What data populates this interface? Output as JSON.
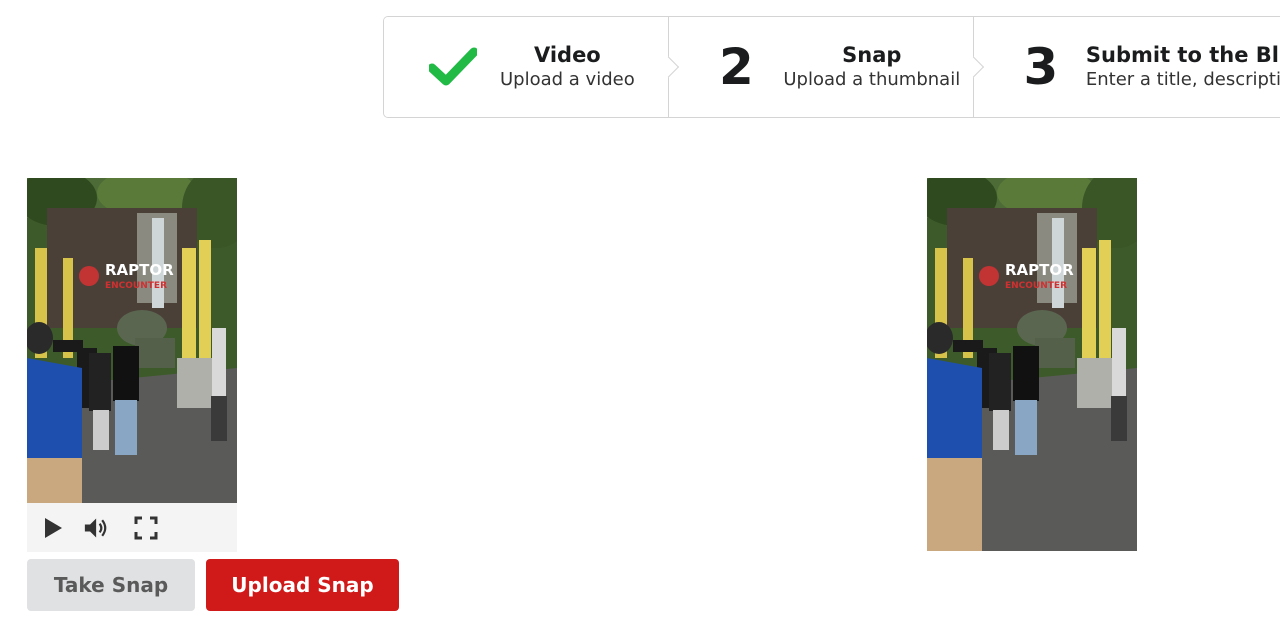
{
  "steps": [
    {
      "id": "video",
      "title": "Video",
      "description": "Upload a video",
      "completed": true,
      "icon": "checkmark-icon"
    },
    {
      "id": "snap",
      "number": "2",
      "title": "Snap",
      "description": "Upload a thumbnail",
      "completed": false
    },
    {
      "id": "submit",
      "number": "3",
      "title": "Submit to the Bl",
      "description": "Enter a title, descriptio",
      "completed": false
    }
  ],
  "video": {
    "poster_text": "RAPTOR",
    "poster_subtext": "ENCOUNTER",
    "controls": {
      "play": "play-icon",
      "volume": "volume-icon",
      "fullscreen": "fullscreen-icon"
    }
  },
  "thumbnail": {
    "poster_text": "RAPTOR",
    "poster_subtext": "ENCOUNTER"
  },
  "buttons": {
    "take_snap": "Take Snap",
    "upload_snap": "Upload Snap"
  },
  "colors": {
    "check_green": "#21ba45",
    "upload_red": "#d01919",
    "take_gray": "#e0e1e2"
  }
}
